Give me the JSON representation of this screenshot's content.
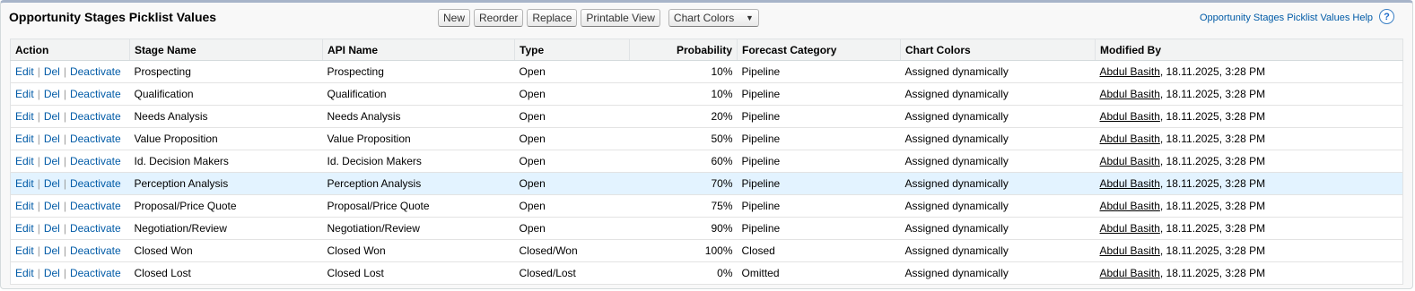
{
  "title": "Opportunity Stages Picklist Values",
  "buttons": {
    "new": "New",
    "reorder": "Reorder",
    "replace": "Replace",
    "printable": "Printable View",
    "chart_colors": "Chart Colors"
  },
  "help": {
    "link": "Opportunity Stages Picklist Values Help",
    "icon": "?"
  },
  "columns": {
    "action": "Action",
    "stage": "Stage Name",
    "api": "API Name",
    "type": "Type",
    "prob": "Probability",
    "forecast": "Forecast Category",
    "colors": "Chart Colors",
    "modified": "Modified By"
  },
  "actions": {
    "edit": "Edit",
    "del": "Del",
    "deactivate": "Deactivate",
    "sep": "|"
  },
  "rows": [
    {
      "stage": "Prospecting",
      "api": "Prospecting",
      "type": "Open",
      "prob": "10%",
      "forecast": "Pipeline",
      "colors": "Assigned dynamically",
      "user": "Abdul Basith",
      "date": ", 18.11.2025, 3:28 PM"
    },
    {
      "stage": "Qualification",
      "api": "Qualification",
      "type": "Open",
      "prob": "10%",
      "forecast": "Pipeline",
      "colors": "Assigned dynamically",
      "user": "Abdul Basith",
      "date": ", 18.11.2025, 3:28 PM"
    },
    {
      "stage": "Needs Analysis",
      "api": "Needs Analysis",
      "type": "Open",
      "prob": "20%",
      "forecast": "Pipeline",
      "colors": "Assigned dynamically",
      "user": "Abdul Basith",
      "date": ", 18.11.2025, 3:28 PM"
    },
    {
      "stage": "Value Proposition",
      "api": "Value Proposition",
      "type": "Open",
      "prob": "50%",
      "forecast": "Pipeline",
      "colors": "Assigned dynamically",
      "user": "Abdul Basith",
      "date": ", 18.11.2025, 3:28 PM"
    },
    {
      "stage": "Id. Decision Makers",
      "api": "Id. Decision Makers",
      "type": "Open",
      "prob": "60%",
      "forecast": "Pipeline",
      "colors": "Assigned dynamically",
      "user": "Abdul Basith",
      "date": ", 18.11.2025, 3:28 PM"
    },
    {
      "stage": "Perception Analysis",
      "api": "Perception Analysis",
      "type": "Open",
      "prob": "70%",
      "forecast": "Pipeline",
      "colors": "Assigned dynamically",
      "user": "Abdul Basith",
      "date": ", 18.11.2025, 3:28 PM"
    },
    {
      "stage": "Proposal/Price Quote",
      "api": "Proposal/Price Quote",
      "type": "Open",
      "prob": "75%",
      "forecast": "Pipeline",
      "colors": "Assigned dynamically",
      "user": "Abdul Basith",
      "date": ", 18.11.2025, 3:28 PM"
    },
    {
      "stage": "Negotiation/Review",
      "api": "Negotiation/Review",
      "type": "Open",
      "prob": "90%",
      "forecast": "Pipeline",
      "colors": "Assigned dynamically",
      "user": "Abdul Basith",
      "date": ", 18.11.2025, 3:28 PM"
    },
    {
      "stage": "Closed Won",
      "api": "Closed Won",
      "type": "Closed/Won",
      "prob": "100%",
      "forecast": "Closed",
      "colors": "Assigned dynamically",
      "user": "Abdul Basith",
      "date": ", 18.11.2025, 3:28 PM"
    },
    {
      "stage": "Closed Lost",
      "api": "Closed Lost",
      "type": "Closed/Lost",
      "prob": "0%",
      "forecast": "Omitted",
      "colors": "Assigned dynamically",
      "user": "Abdul Basith",
      "date": ", 18.11.2025, 3:28 PM"
    }
  ],
  "highlighted_row": "Perception Analysis"
}
